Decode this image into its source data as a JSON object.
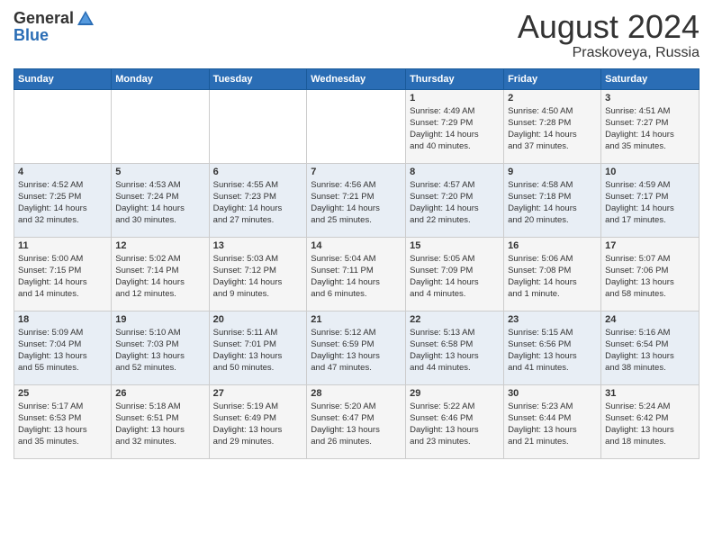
{
  "header": {
    "logo_general": "General",
    "logo_blue": "Blue",
    "month_year": "August 2024",
    "location": "Praskoveya, Russia"
  },
  "weekdays": [
    "Sunday",
    "Monday",
    "Tuesday",
    "Wednesday",
    "Thursday",
    "Friday",
    "Saturday"
  ],
  "weeks": [
    [
      {
        "day": "",
        "detail": ""
      },
      {
        "day": "",
        "detail": ""
      },
      {
        "day": "",
        "detail": ""
      },
      {
        "day": "",
        "detail": ""
      },
      {
        "day": "1",
        "detail": "Sunrise: 4:49 AM\nSunset: 7:29 PM\nDaylight: 14 hours\nand 40 minutes."
      },
      {
        "day": "2",
        "detail": "Sunrise: 4:50 AM\nSunset: 7:28 PM\nDaylight: 14 hours\nand 37 minutes."
      },
      {
        "day": "3",
        "detail": "Sunrise: 4:51 AM\nSunset: 7:27 PM\nDaylight: 14 hours\nand 35 minutes."
      }
    ],
    [
      {
        "day": "4",
        "detail": "Sunrise: 4:52 AM\nSunset: 7:25 PM\nDaylight: 14 hours\nand 32 minutes."
      },
      {
        "day": "5",
        "detail": "Sunrise: 4:53 AM\nSunset: 7:24 PM\nDaylight: 14 hours\nand 30 minutes."
      },
      {
        "day": "6",
        "detail": "Sunrise: 4:55 AM\nSunset: 7:23 PM\nDaylight: 14 hours\nand 27 minutes."
      },
      {
        "day": "7",
        "detail": "Sunrise: 4:56 AM\nSunset: 7:21 PM\nDaylight: 14 hours\nand 25 minutes."
      },
      {
        "day": "8",
        "detail": "Sunrise: 4:57 AM\nSunset: 7:20 PM\nDaylight: 14 hours\nand 22 minutes."
      },
      {
        "day": "9",
        "detail": "Sunrise: 4:58 AM\nSunset: 7:18 PM\nDaylight: 14 hours\nand 20 minutes."
      },
      {
        "day": "10",
        "detail": "Sunrise: 4:59 AM\nSunset: 7:17 PM\nDaylight: 14 hours\nand 17 minutes."
      }
    ],
    [
      {
        "day": "11",
        "detail": "Sunrise: 5:00 AM\nSunset: 7:15 PM\nDaylight: 14 hours\nand 14 minutes."
      },
      {
        "day": "12",
        "detail": "Sunrise: 5:02 AM\nSunset: 7:14 PM\nDaylight: 14 hours\nand 12 minutes."
      },
      {
        "day": "13",
        "detail": "Sunrise: 5:03 AM\nSunset: 7:12 PM\nDaylight: 14 hours\nand 9 minutes."
      },
      {
        "day": "14",
        "detail": "Sunrise: 5:04 AM\nSunset: 7:11 PM\nDaylight: 14 hours\nand 6 minutes."
      },
      {
        "day": "15",
        "detail": "Sunrise: 5:05 AM\nSunset: 7:09 PM\nDaylight: 14 hours\nand 4 minutes."
      },
      {
        "day": "16",
        "detail": "Sunrise: 5:06 AM\nSunset: 7:08 PM\nDaylight: 14 hours\nand 1 minute."
      },
      {
        "day": "17",
        "detail": "Sunrise: 5:07 AM\nSunset: 7:06 PM\nDaylight: 13 hours\nand 58 minutes."
      }
    ],
    [
      {
        "day": "18",
        "detail": "Sunrise: 5:09 AM\nSunset: 7:04 PM\nDaylight: 13 hours\nand 55 minutes."
      },
      {
        "day": "19",
        "detail": "Sunrise: 5:10 AM\nSunset: 7:03 PM\nDaylight: 13 hours\nand 52 minutes."
      },
      {
        "day": "20",
        "detail": "Sunrise: 5:11 AM\nSunset: 7:01 PM\nDaylight: 13 hours\nand 50 minutes."
      },
      {
        "day": "21",
        "detail": "Sunrise: 5:12 AM\nSunset: 6:59 PM\nDaylight: 13 hours\nand 47 minutes."
      },
      {
        "day": "22",
        "detail": "Sunrise: 5:13 AM\nSunset: 6:58 PM\nDaylight: 13 hours\nand 44 minutes."
      },
      {
        "day": "23",
        "detail": "Sunrise: 5:15 AM\nSunset: 6:56 PM\nDaylight: 13 hours\nand 41 minutes."
      },
      {
        "day": "24",
        "detail": "Sunrise: 5:16 AM\nSunset: 6:54 PM\nDaylight: 13 hours\nand 38 minutes."
      }
    ],
    [
      {
        "day": "25",
        "detail": "Sunrise: 5:17 AM\nSunset: 6:53 PM\nDaylight: 13 hours\nand 35 minutes."
      },
      {
        "day": "26",
        "detail": "Sunrise: 5:18 AM\nSunset: 6:51 PM\nDaylight: 13 hours\nand 32 minutes."
      },
      {
        "day": "27",
        "detail": "Sunrise: 5:19 AM\nSunset: 6:49 PM\nDaylight: 13 hours\nand 29 minutes."
      },
      {
        "day": "28",
        "detail": "Sunrise: 5:20 AM\nSunset: 6:47 PM\nDaylight: 13 hours\nand 26 minutes."
      },
      {
        "day": "29",
        "detail": "Sunrise: 5:22 AM\nSunset: 6:46 PM\nDaylight: 13 hours\nand 23 minutes."
      },
      {
        "day": "30",
        "detail": "Sunrise: 5:23 AM\nSunset: 6:44 PM\nDaylight: 13 hours\nand 21 minutes."
      },
      {
        "day": "31",
        "detail": "Sunrise: 5:24 AM\nSunset: 6:42 PM\nDaylight: 13 hours\nand 18 minutes."
      }
    ]
  ]
}
